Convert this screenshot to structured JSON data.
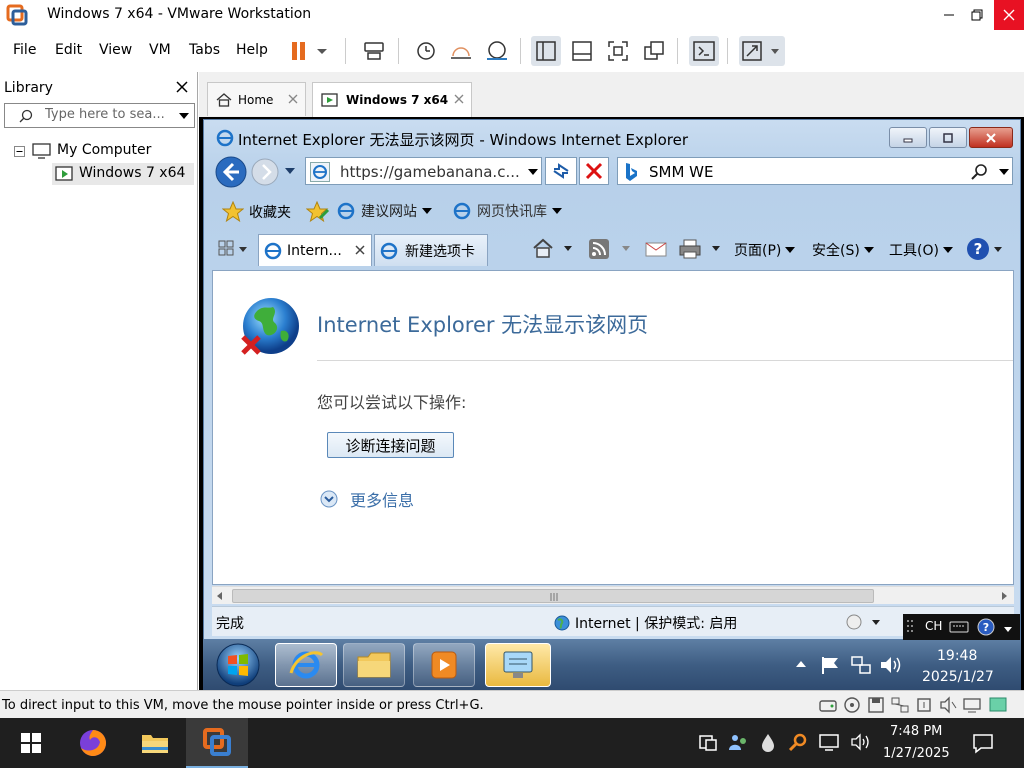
{
  "app": {
    "title": "Windows 7 x64 - VMware Workstation",
    "menus": [
      "File",
      "Edit",
      "View",
      "VM",
      "Tabs",
      "Help"
    ],
    "accent": "#e56b1f"
  },
  "library": {
    "title": "Library",
    "search_placeholder": "Type here to sea...",
    "tree": [
      {
        "label": "My Computer"
      },
      {
        "label": "Windows 7 x64"
      }
    ]
  },
  "tabs": [
    {
      "label": "Home",
      "active": false
    },
    {
      "label": "Windows 7 x64",
      "active": true
    }
  ],
  "ie": {
    "title": "Internet Explorer 无法显示该网页 - Windows Internet Explorer",
    "address": "https://gamebanana.c...",
    "search_value": "SMM WE",
    "favorites": {
      "label": "收藏夹",
      "suggested_sites": "建议网站",
      "web_slice_gallery": "网页快讯库"
    },
    "tabs": [
      {
        "label": "Intern...",
        "active": true
      },
      {
        "label": "新建选项卡",
        "active": false
      }
    ],
    "command_bar": {
      "page": "页面(P)",
      "safety": "安全(S)",
      "tools": "工具(O)"
    },
    "content": {
      "heading": "Internet Explorer 无法显示该网页",
      "try_text": "您可以尝试以下操作:",
      "diagnose_button": "诊断连接问题",
      "more_info": "更多信息"
    },
    "status": {
      "left": "完成",
      "zone": "Internet | 保护模式: 启用"
    }
  },
  "guest_taskbar": {
    "language": "CH",
    "time": "19:48",
    "date": "2025/1/27"
  },
  "vm_status": {
    "message": "To direct input to this VM, move the mouse pointer inside or press Ctrl+G."
  },
  "host_taskbar": {
    "time": "7:48 PM",
    "date": "1/27/2025"
  }
}
